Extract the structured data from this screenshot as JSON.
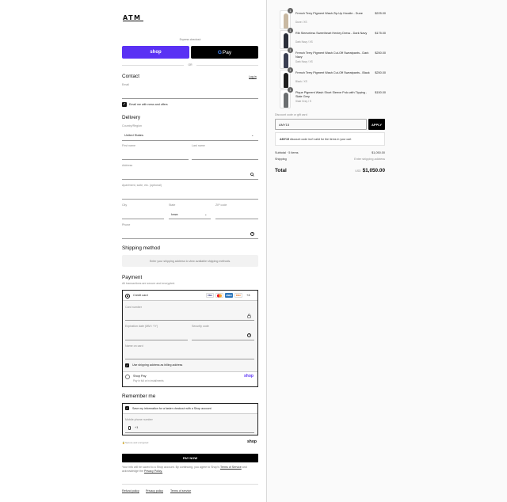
{
  "brand": {
    "logo": "ATM"
  },
  "express": {
    "label": "Express checkout",
    "shop_pay": "shop",
    "gpay_g": "G",
    "gpay_text": "Pay",
    "or": "OR"
  },
  "contact": {
    "title": "Contact",
    "login": "Log in",
    "email_label": "Email",
    "email_value": "",
    "news_label": "Email me with news and offers",
    "news_checked": true
  },
  "delivery": {
    "title": "Delivery",
    "country_label": "Country/Region",
    "country_value": "United States",
    "first_name": "First name",
    "last_name": "Last name",
    "address": "Address",
    "apartment": "Apartment, suite, etc. (optional)",
    "city": "City",
    "state_label": "State",
    "state_value": "Iowa",
    "zip": "ZIP code",
    "phone": "Phone"
  },
  "shipping": {
    "title": "Shipping method",
    "note": "Enter your shipping address to view available shipping methods."
  },
  "payment": {
    "title": "Payment",
    "subtitle": "All transactions are secure and encrypted.",
    "credit_card": "Credit card",
    "card_brands": [
      "VISA",
      "MC",
      "AMEX",
      "DISC"
    ],
    "card_more": "+4",
    "card_number": "Card number",
    "expiry": "Expiration date (MM / YY)",
    "security": "Security code",
    "name_on_card": "Name on card",
    "billing_same": "Use shipping address as billing address",
    "shop_pay": "Shop Pay",
    "shop_pay_sub": "Pay in full or in installments",
    "shop_pay_logo": "shop"
  },
  "remember": {
    "title": "Remember me",
    "save_label": "Save my information for a faster checkout with a Shop account",
    "mobile_label": "Mobile phone number",
    "mobile_prefix": "+1",
    "secure_note": "Secure and encrypted",
    "shop_logo": "shop"
  },
  "pay_now": "PAY NOW",
  "legal": {
    "text": "Your info will be saved to a Shop account. By continuing, you agree to Shop's",
    "terms": "Terms of Service",
    "and": "and acknowledge the",
    "privacy": "Privacy Policy."
  },
  "footer": [
    "Refund policy",
    "Privacy policy",
    "Terms of service"
  ],
  "cart": {
    "items": [
      {
        "name": "French Terry Pigment Wash Zip-Up Hoodie - Dune",
        "variant": "Dune / XS",
        "price": "$225.00",
        "qty": "1",
        "color": "#c9b9a2"
      },
      {
        "name": "Rib Sleeveless Sweetheart Henley Dress - Dark Navy",
        "variant": "Dark Navy / XS",
        "price": "$175.00",
        "qty": "1",
        "color": "#2b2f3a"
      },
      {
        "name": "French Terry Pigment Wash Cut-Off Sweatpants - Dark Navy",
        "variant": "Dark Navy / XS",
        "price": "$250.00",
        "qty": "1",
        "color": "#3a3f52"
      },
      {
        "name": "French Terry Pigment Wash Cut-Off Sweatpants - Black",
        "variant": "Black / XS",
        "price": "$250.00",
        "qty": "1",
        "color": "#1e1e1e"
      },
      {
        "name": "Pique Pigment Wash Short Sleeve Polo with Tipping - Slate Grey",
        "variant": "Slate Grey / S",
        "price": "$150.00",
        "qty": "1",
        "color": "#6b6e70"
      }
    ],
    "discount_label": "Discount code or gift card",
    "discount_value": "AMY15",
    "apply": "APPLY",
    "discount_msg_code": "AMY15",
    "discount_msg": "discount code isn't valid for the items in your cart",
    "subtotal_label": "Subtotal · 5 items",
    "subtotal_value": "$1,050.00",
    "shipping_label": "Shipping",
    "shipping_value": "Enter shipping address",
    "total_label": "Total",
    "total_currency": "USD",
    "total_value": "$1,050.00"
  }
}
